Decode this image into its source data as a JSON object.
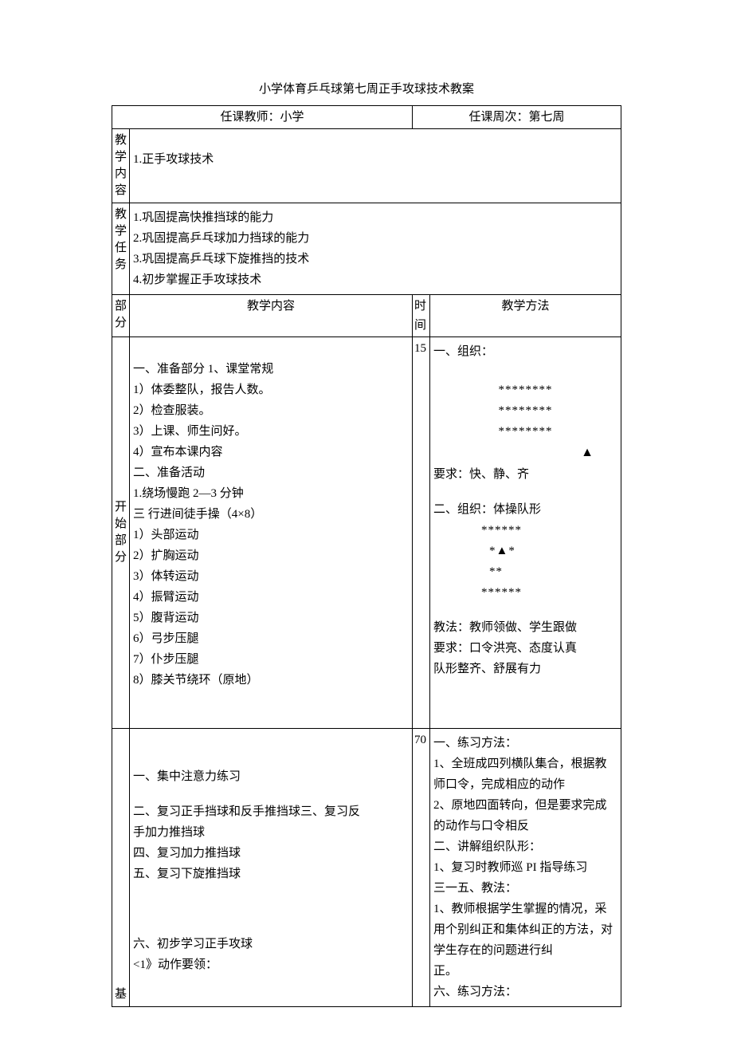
{
  "title": "小学体育乒乓球第七周正手攻球技术教案",
  "header": {
    "teacher": "任课教师：小学",
    "week": "任课周次：第七周"
  },
  "labels": {
    "teachContent": "教学内容",
    "teachTask": "教学任务",
    "part": "部分",
    "col_content": "教学内容",
    "col_time": "时间",
    "col_method": "教学方法",
    "startPart": "开始部分",
    "basicPart": "基"
  },
  "teachContent": "1.正手攻球技术",
  "teachTasks": [
    "1.巩固提高快推挡球的能力",
    "2.巩固提高乒乓球加力挡球的能力",
    "3.巩固提高乒乓球下旋推挡的技术",
    "4.初步掌握正手攻球技术"
  ],
  "row1": {
    "time": "15",
    "content": {
      "prep_title": "一、准备部分 1、课堂常规",
      "items1": [
        "1）体委整队，报告人数。",
        "2）检查服装。",
        "3）上课、师生问好。",
        "4）宣布本课内容"
      ],
      "act_title": "二、准备活动",
      "act1": "1.绕场慢跑 2—3 分钟",
      "act2": "三 行进间徒手操（4×8）",
      "ex": [
        "1）头部运动",
        "2）扩胸运动",
        "3）体转运动",
        "4）振臂运动",
        "5）腹背运动",
        "6）弓步压腿",
        "7）仆步压腿",
        "8）膝关节绕环（原地）"
      ]
    },
    "method": {
      "org1": "一、组织：",
      "stars1": "********",
      "stars2": "********",
      "stars3": "********",
      "tri1": "▲",
      "req1": "要求：快、静、齐",
      "org2": "二、组织：体操队形",
      "sa": "******",
      "sb": "*▲*",
      "sc": "**",
      "sd": "******",
      "teach1": "教法：教师领做、学生跟做",
      "teach2": "要求：口令洪亮、态度认真",
      "teach3": "队形整齐、舒展有力"
    }
  },
  "row2": {
    "time": "70",
    "content": {
      "l1": "一、集中注意力练习",
      "l2a": "二、复习正手挡球和反手推挡球三、复习反",
      "l2b": "手加力推挡球",
      "l3": "四、复习加力推挡球",
      "l4": "五、复习下旋推挡球",
      "l5": "六、初步学习正手攻球",
      "l6": "<1》动作要领："
    },
    "method": {
      "m1": "一、练习方法：",
      "m2a": "1、全班成四列横队集合，根据教",
      "m2b": "师口令，完成相应的动作",
      "m3a": "2、原地四面转向，但是要求完成",
      "m3b": "的动作与口令相反",
      "m4": "二、讲解组织队形：",
      "m5": "1、复习时教师巡 PI 指导练习",
      "m6": "三一五、教法：",
      "m7a": "1、教师根据学生掌握的情况，采",
      "m7b": "用个别纠正和集体纠正的方法，对",
      "m7c": "学生存在的问题进行纠",
      "m8": "正。",
      "m9": "六、练习方法："
    }
  }
}
